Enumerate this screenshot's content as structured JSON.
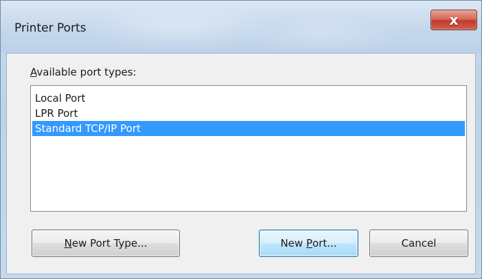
{
  "window": {
    "title": "Printer Ports",
    "close_glyph": "x"
  },
  "port_list": {
    "label_accesskey": "A",
    "label_rest": "vailable port types:",
    "items": [
      {
        "label": "Local Port",
        "selected": false
      },
      {
        "label": "LPR Port",
        "selected": false
      },
      {
        "label": "Standard TCP/IP Port",
        "selected": true
      }
    ]
  },
  "buttons": {
    "new_port_type": {
      "accesskey": "N",
      "rest": "ew Port Type..."
    },
    "new_port": {
      "pre": "New ",
      "accesskey": "P",
      "rest": "ort..."
    },
    "cancel": {
      "label": "Cancel"
    }
  },
  "colors": {
    "selection": "#3399ff",
    "close_button": "#c0392b",
    "dialog_face": "#f0f0f0"
  }
}
